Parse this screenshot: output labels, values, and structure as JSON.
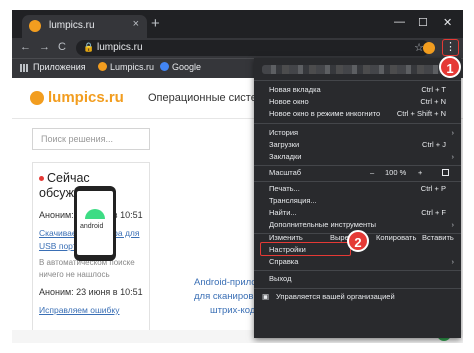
{
  "window": {
    "tab_title": "lumpics.ru",
    "close_glyph": "×",
    "new_tab_glyph": "+",
    "minimize_glyph": "—",
    "maximize_glyph": "☐",
    "close_window_glyph": "✕"
  },
  "toolbar": {
    "back_glyph": "←",
    "forward_glyph": "→",
    "reload_glyph": "C",
    "lock_glyph": "🔒",
    "url": "lumpics.ru",
    "star_glyph": "☆",
    "menu_glyph": "⋮"
  },
  "bookmarks": {
    "items": [
      "Приложения",
      "Lumpics.ru",
      "Google"
    ]
  },
  "site": {
    "logo_text": "lumpics.ru",
    "nav_text": "Операционные системы",
    "search_placeholder": "Поиск решения...",
    "now_title": "Сейчас обсуждаем",
    "comments": [
      {
        "author": "Аноним: 23 июня в 10:51",
        "link_line1": "Скачиваем драйвера для",
        "link_line2": "USB портов",
        "grey_line1": "В автоматическом поиске",
        "grey_line2": "ничего не нашлось"
      },
      {
        "author": "Аноним: 23 июня в 10:51",
        "link_line1": "Исправляем ошибку"
      }
    ],
    "android_label": "android",
    "card_caption_line1": "Android-прилож",
    "card_caption_line2": "для сканиров",
    "card_caption_line3": "штрих-кодов"
  },
  "menu": {
    "new_tab": "Новая вкладка",
    "new_tab_sc": "Ctrl + T",
    "new_window": "Новое окно",
    "new_window_sc": "Ctrl + N",
    "incognito": "Новое окно в режиме инкогнито",
    "incognito_sc": "Ctrl + Shift + N",
    "history": "История",
    "downloads": "Загрузки",
    "downloads_sc": "Ctrl + J",
    "bookmarks": "Закладки",
    "zoom": "Масштаб",
    "zoom_minus": "–",
    "zoom_value": "100 %",
    "zoom_plus": "+",
    "print": "Печать...",
    "print_sc": "Ctrl + P",
    "cast": "Трансляция...",
    "find": "Найти...",
    "find_sc": "Ctrl + F",
    "more_tools": "Дополнительные инструменты",
    "edit": "Изменить",
    "cut": "Вырезать",
    "copy": "Копировать",
    "paste": "Вставить",
    "settings": "Настройки",
    "help": "Справка",
    "exit": "Выход",
    "managed": "Управляется вашей организацией",
    "arrow": "›"
  },
  "badges": {
    "step1": "1",
    "step2": "2"
  },
  "colors": {
    "accent": "#f29d1f",
    "highlight": "#e53935",
    "menu_bg": "#292a2d",
    "chrome_dark": "#202124"
  }
}
